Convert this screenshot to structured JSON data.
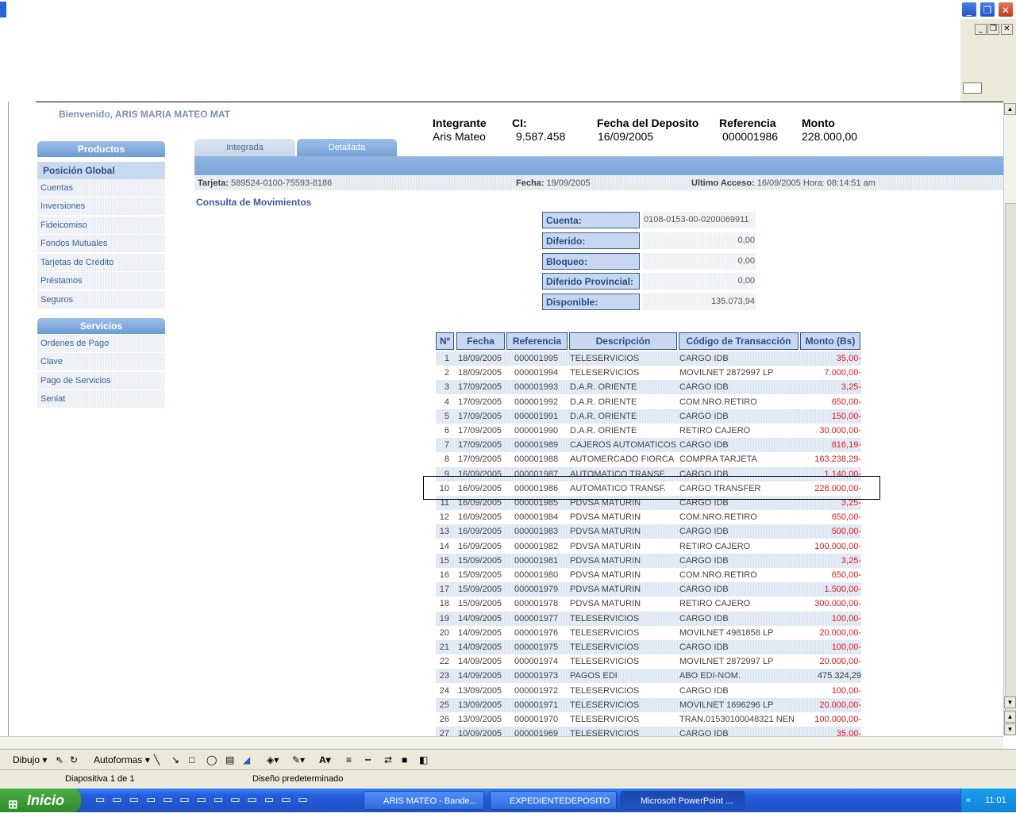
{
  "window": {
    "min_label": "_",
    "max_label": "❐",
    "close_label": "✕"
  },
  "page": {
    "welcome": "Bienvenido, ARIS MARIA MATEO MAT"
  },
  "deposit_header": [
    {
      "label": "Integrante",
      "value": "Aris Mateo"
    },
    {
      "label": "CI:",
      "value": "9.587.458"
    },
    {
      "label": "Fecha del Deposito",
      "value": "16/09/2005"
    },
    {
      "label": "Referencia",
      "value": "000001986"
    },
    {
      "label": "Monto",
      "value": "228.000,00"
    }
  ],
  "sidebar": {
    "productos_title": "Productos",
    "productos": [
      "Posición Global",
      "Cuentas",
      "Inversiones",
      "Fideicomiso",
      "Fondos Mutuales",
      "Tarjetas de Crédito",
      "Préstamos",
      "Seguros"
    ],
    "servicios_title": "Servicios",
    "servicios": [
      "Ordenes de Pago",
      "Clave",
      "Pago de Servicios",
      "Seniat"
    ]
  },
  "tabs": {
    "integrada": "Integrada",
    "detallada": "Detallada"
  },
  "info": {
    "tarjeta_label": "Tarjeta:",
    "tarjeta": "589524-0100-75593-8186",
    "fecha_label": "Fecha:",
    "fecha": "19/09/2005",
    "acceso_label": "Ultimo Acceso:",
    "acceso": "16/09/2005 Hora: 08:14:51 am"
  },
  "section_title": "Consulta de Movimientos",
  "summary": [
    {
      "label": "Cuenta:",
      "value": "0108-0153-00-0200069911"
    },
    {
      "label": "Diferido:",
      "value": "0,00"
    },
    {
      "label": "Bloqueo:",
      "value": "0,00"
    },
    {
      "label": "Diferido Provincial:",
      "value": "0,00"
    },
    {
      "label": "Disponible:",
      "value": "135.073,94"
    }
  ],
  "table": {
    "headers": [
      "Nº",
      "Fecha",
      "Referencia",
      "Descripción",
      "Código de Transacción",
      "Monto (Bs)"
    ],
    "rows": [
      [
        "1",
        "18/09/2005",
        "000001995",
        "TELESERVICIOS",
        "CARGO IDB",
        "35,00-"
      ],
      [
        "2",
        "18/09/2005",
        "000001994",
        "TELESERVICIOS",
        "MOVILNET 2872997 LP",
        "7.000,00-"
      ],
      [
        "3",
        "17/09/2005",
        "000001993",
        "D.A.R. ORIENTE",
        "CARGO IDB",
        "3,25-"
      ],
      [
        "4",
        "17/09/2005",
        "000001992",
        "D.A.R. ORIENTE",
        "COM.NRO.RETIRO",
        "650,00-"
      ],
      [
        "5",
        "17/09/2005",
        "000001991",
        "D.A.R. ORIENTE",
        "CARGO IDB",
        "150,00-"
      ],
      [
        "6",
        "17/09/2005",
        "000001990",
        "D.A.R. ORIENTE",
        "RETIRO CAJERO",
        "30.000,00-"
      ],
      [
        "7",
        "17/09/2005",
        "000001989",
        "CAJEROS AUTOMATICOS",
        "CARGO IDB",
        "816,19-"
      ],
      [
        "8",
        "17/09/2005",
        "000001988",
        "AUTOMERCADO FIORCA",
        "COMPRA TARJETA",
        "163.238,29-"
      ],
      [
        "9",
        "16/09/2005",
        "000001987",
        "AUTOMATICO TRANSF.",
        "CARGO IDB",
        "1.140,00-"
      ],
      [
        "10",
        "16/09/2005",
        "000001986",
        "AUTOMATICO TRANSF.",
        "CARGO TRANSFER",
        "228.000,00-"
      ],
      [
        "11",
        "16/09/2005",
        "000001985",
        "PDVSA MATURIN",
        "CARGO IDB",
        "3,25-"
      ],
      [
        "12",
        "16/09/2005",
        "000001984",
        "PDVSA MATURIN",
        "COM.NRO.RETIRO",
        "650,00-"
      ],
      [
        "13",
        "16/09/2005",
        "000001983",
        "PDVSA MATURIN",
        "CARGO IDB",
        "500,00-"
      ],
      [
        "14",
        "16/09/2005",
        "000001982",
        "PDVSA MATURIN",
        "RETIRO CAJERO",
        "100.000,00-"
      ],
      [
        "15",
        "15/09/2005",
        "000001981",
        "PDVSA MATURIN",
        "CARGO IDB",
        "3,25-"
      ],
      [
        "16",
        "15/09/2005",
        "000001980",
        "PDVSA MATURIN",
        "COM.NRO.RETIRO",
        "650,00-"
      ],
      [
        "17",
        "15/09/2005",
        "000001979",
        "PDVSA MATURIN",
        "CARGO IDB",
        "1.500,00-"
      ],
      [
        "18",
        "15/09/2005",
        "000001978",
        "PDVSA MATURIN",
        "RETIRO CAJERO",
        "300.000,00-"
      ],
      [
        "19",
        "14/09/2005",
        "000001977",
        "TELESERVICIOS",
        "CARGO IDB",
        "100,00-"
      ],
      [
        "20",
        "14/09/2005",
        "000001976",
        "TELESERVICIOS",
        "MOVILNET 4981858 LP",
        "20.000,00-"
      ],
      [
        "21",
        "14/09/2005",
        "000001975",
        "TELESERVICIOS",
        "CARGO IDB",
        "100,00-"
      ],
      [
        "22",
        "14/09/2005",
        "000001974",
        "TELESERVICIOS",
        "MOVILNET 2872997 LP",
        "20.000,00-"
      ],
      [
        "23",
        "14/09/2005",
        "000001973",
        "PAGOS EDI",
        "ABO EDI-NOM.",
        "475.324,29"
      ],
      [
        "24",
        "13/09/2005",
        "000001972",
        "TELESERVICIOS",
        "CARGO IDB",
        "100,00-"
      ],
      [
        "25",
        "13/09/2005",
        "000001971",
        "TELESERVICIOS",
        "MOVILNET 1696296 LP",
        "20.000,00-"
      ],
      [
        "26",
        "13/09/2005",
        "000001970",
        "TELESERVICIOS",
        "TRAN.01530100048321 NEN",
        "100.000,00-"
      ],
      [
        "27",
        "10/09/2005",
        "000001969",
        "TELESERVICIOS",
        "CARGO IDB",
        "35,00-"
      ]
    ]
  },
  "draw_toolbar": {
    "dibujo": "Dibujo ▾",
    "autoformas": "Autoformas ▾"
  },
  "status": {
    "slide": "Diapositiva 1 de 1",
    "design": "Diseño predeterminado"
  },
  "taskbar": {
    "start": "Inicio",
    "items": [
      "ARIS MATEO - Bande...",
      "EXPEDIENTEDEPOSITO",
      "Microsoft PowerPoint ..."
    ],
    "clock": "11:01"
  }
}
